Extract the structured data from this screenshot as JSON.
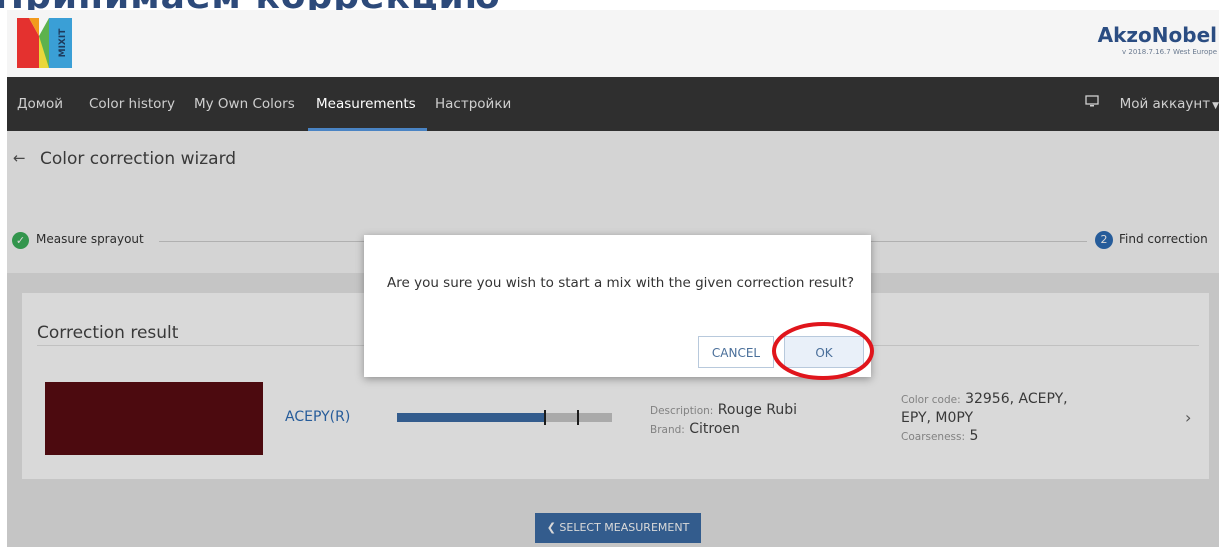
{
  "page_heading": "Принимаем коррекцию",
  "header": {
    "logo_text": "MIXIT",
    "brand_name": "AkzoNobel",
    "brand_version": "v 2018.7.16.7 West Europe"
  },
  "nav": {
    "items": [
      {
        "label": "Домой"
      },
      {
        "label": "Color history"
      },
      {
        "label": "My Own Colors"
      },
      {
        "label": "Measurements"
      },
      {
        "label": "Настройки"
      }
    ],
    "account_label": "Мой аккаунт"
  },
  "wizard": {
    "back_icon": "←",
    "title": "Color correction wizard",
    "steps": [
      {
        "label": "Measure sprayout",
        "state": "done"
      },
      {
        "number": "2",
        "label": "Find correction",
        "state": "active"
      }
    ]
  },
  "result": {
    "title": "Correction result",
    "swatch_color": "#5a0c12",
    "code": "ACEPY(R)",
    "bar_fill": 0.69,
    "description_label": "Description:",
    "description": "Rouge Rubi",
    "brand_label": "Brand:",
    "brand": "Citroen",
    "color_code_label": "Color code:",
    "color_code": "32956, ACEPY, EPY, M0PY",
    "coarseness_label": "Coarseness:",
    "coarseness": "5",
    "chevron": "›"
  },
  "select_button_label": "❮ SELECT MEASUREMENT",
  "dialog": {
    "message": "Are you sure you wish to start a mix with the given correction result?",
    "cancel_label": "CANCEL",
    "ok_label": "OK"
  },
  "colors": {
    "accent": "#2d6db6",
    "nav_bg": "#2f2f2f",
    "success": "#3cb05b",
    "highlight": "#e0151c"
  }
}
